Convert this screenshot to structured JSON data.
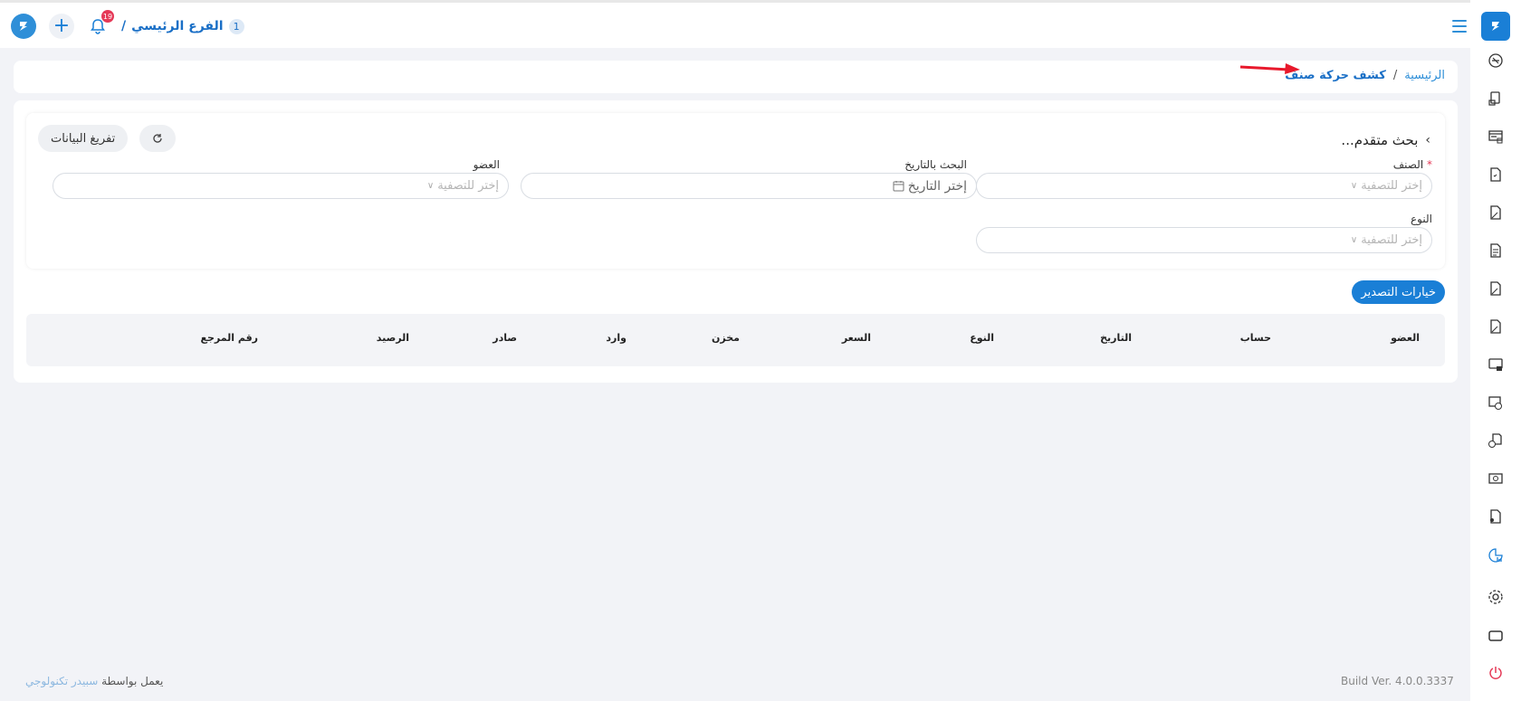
{
  "topbar": {
    "branch_number": "1",
    "branch_name": "الفرع الرئيسي",
    "branch_separator": "/",
    "notification_count": "19"
  },
  "breadcrumb": {
    "home": "الرئيسية",
    "separator": "/",
    "current": "كشف حركة صنف"
  },
  "search": {
    "title": "بحث متقدم...",
    "clear_label": "تفريغ البيانات",
    "fields": {
      "item_label": "الصنف",
      "item_required": "*",
      "item_placeholder": "إختر للتصفية",
      "date_label": "البحث بالتاريخ",
      "date_placeholder": "إختر التاريخ",
      "member_label": "العضو",
      "member_placeholder": "إختر للتصفية",
      "type_label": "النوع",
      "type_placeholder": "إختر للتصفية"
    }
  },
  "export_label": "خيارات التصدير",
  "table": {
    "columns": [
      "العضو",
      "حساب",
      "التاريخ",
      "النوع",
      "السعر",
      "مخزن",
      "وارد",
      "صادر",
      "الرصيد",
      "رقم المرجع"
    ]
  },
  "footer": {
    "powered_prefix": "يعمل بواسطة",
    "company": "سبيدر تكنولوجي",
    "build": "Build Ver. 4.0.0.3337"
  },
  "colors": {
    "accent": "#1a7fd6",
    "required": "#e53957",
    "annotation_arrow": "#e8192c",
    "background": "#f2f3f7"
  },
  "sidebar_icons": [
    "dashboard-icon",
    "invoice-icon",
    "pos-icon",
    "document-icon",
    "edit-document-icon",
    "report-document-icon",
    "edit-document-icon",
    "edit-document-icon",
    "screen-icon",
    "money-add-icon",
    "add-document-icon",
    "cash-icon",
    "user-document-icon",
    "chart-icon",
    "settings-icon",
    "window-icon",
    "power-icon"
  ]
}
